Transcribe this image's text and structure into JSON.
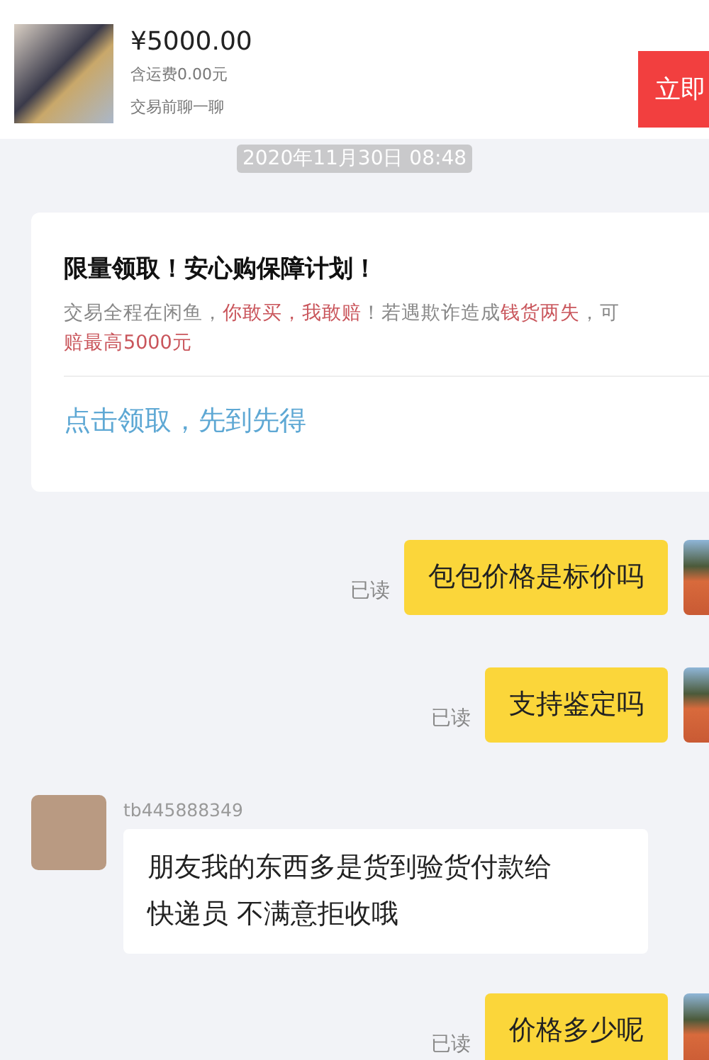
{
  "product": {
    "price": "¥5000.00",
    "shipping": "含运费0.00元",
    "hint": "交易前聊一聊",
    "buy_button": "立即"
  },
  "timestamp": "2020年11月30日 08:48",
  "promo_card": {
    "title": "限量领取！安心购保障计划！",
    "description": [
      [
        {
          "text": "交易全程在闲鱼，",
          "highlight": false
        },
        {
          "text": "你敢买，我敢赔",
          "highlight": true
        },
        {
          "text": "！若遇欺诈造成",
          "highlight": false
        },
        {
          "text": "钱货两失",
          "highlight": true
        },
        {
          "text": "，可",
          "highlight": false
        }
      ],
      [
        {
          "text": "赔最高5000元",
          "highlight": true
        }
      ]
    ],
    "link": "点击领取，先到先得"
  },
  "messages": [
    {
      "kind": "outgoing",
      "text": "包包价格是标价吗",
      "status": "已读"
    },
    {
      "kind": "outgoing",
      "text": "支持鉴定吗",
      "status": "已读"
    },
    {
      "kind": "incoming",
      "sender": "tb445888349",
      "lines": [
        "朋友我的东西多是货到验货付款给",
        "快递员 不满意拒收哦"
      ]
    },
    {
      "kind": "outgoing",
      "text": "价格多少呢",
      "status": "已读"
    }
  ]
}
